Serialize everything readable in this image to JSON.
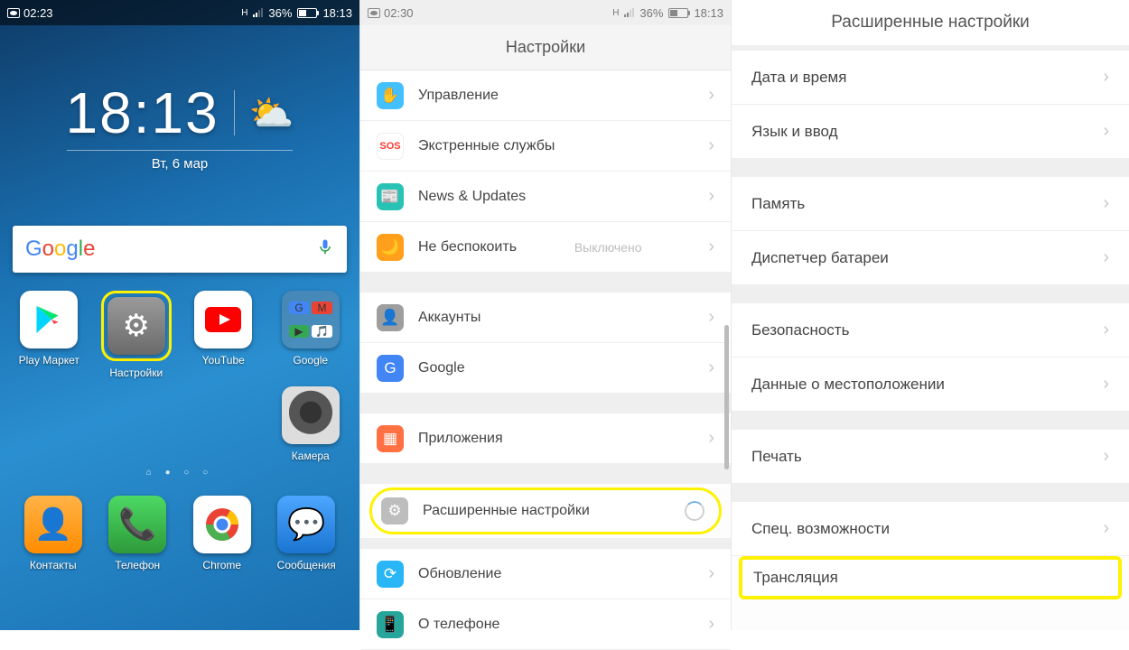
{
  "p1": {
    "status": {
      "rec_time": "02:23",
      "net_h": "H",
      "battery_pct": "36%",
      "time": "18:13"
    },
    "clock": {
      "time": "18:13",
      "date": "Вт, 6 мар"
    },
    "search": {
      "logo": "Google"
    },
    "apps": [
      {
        "name": "play",
        "label": "Play Маркет"
      },
      {
        "name": "settings",
        "label": "Настройки",
        "highlighted": true
      },
      {
        "name": "youtube",
        "label": "YouTube"
      },
      {
        "name": "google",
        "label": "Google"
      },
      {
        "name": "camera",
        "label": "Камера"
      }
    ],
    "dock": [
      {
        "name": "contacts",
        "label": "Контакты"
      },
      {
        "name": "phone",
        "label": "Телефон"
      },
      {
        "name": "chrome",
        "label": "Chrome"
      },
      {
        "name": "messages",
        "label": "Сообщения"
      }
    ]
  },
  "p2": {
    "status": {
      "rec_time": "02:30",
      "net_h": "H",
      "battery_pct": "36%",
      "time": "18:13"
    },
    "title": "Настройки",
    "rows": {
      "r1": "Управление",
      "r2": "Экстренные службы",
      "r3": "News & Updates",
      "r4": "Не беспокоить",
      "r4_val": "Выключено",
      "r5": "Аккаунты",
      "r6": "Google",
      "r7": "Приложения",
      "r8": "Расширенные настройки",
      "r9": "Обновление",
      "r10": "О телефоне"
    }
  },
  "p3": {
    "title": "Расширенные настройки",
    "rows": {
      "r1": "Дата и время",
      "r2": "Язык и ввод",
      "r3": "Память",
      "r4": "Диспетчер батареи",
      "r5": "Безопасность",
      "r6": "Данные о местоположении",
      "r7": "Печать",
      "r8": "Спец. возможности",
      "r9": "Трансляция"
    }
  }
}
